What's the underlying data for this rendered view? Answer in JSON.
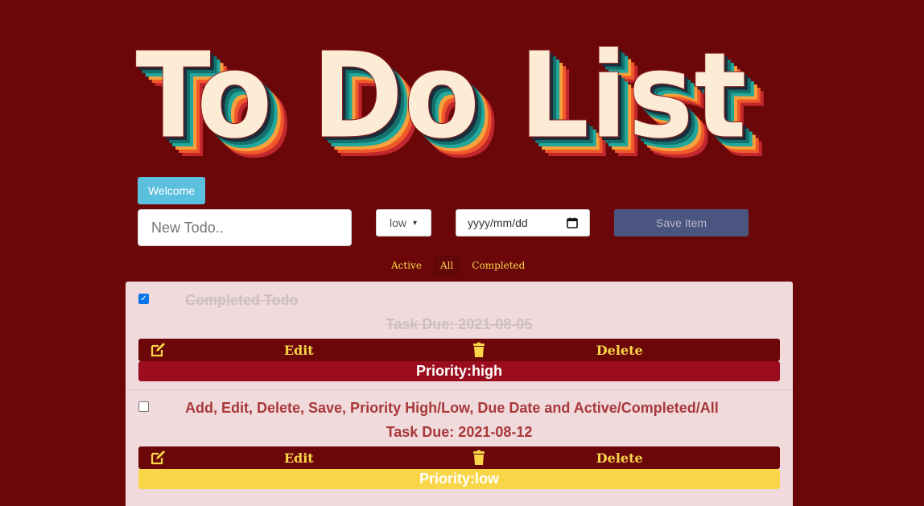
{
  "header": {
    "logo_text": "To Do List",
    "logo_shadow_colors": [
      "#c1272d",
      "#f0582a",
      "#f6a13b",
      "#21a79c",
      "#15716e",
      "#1b2d3b"
    ],
    "logo_face_color": "#fdecd5"
  },
  "welcome_button": {
    "label": "Welcome"
  },
  "form": {
    "todo_placeholder": "New Todo..",
    "priority_selected": "low",
    "date_placeholder": "yyyy/mm/dd",
    "save_label": "Save Item"
  },
  "filters": [
    {
      "label": "Active"
    },
    {
      "label": "All"
    },
    {
      "label": "Completed"
    }
  ],
  "active_filter": "All",
  "todos": [
    {
      "completed": true,
      "title": "Completed Todo",
      "due": "Task Due: 2021-08-05",
      "edit_label": "Edit",
      "delete_label": "Delete",
      "priority_label": "Priority:high",
      "priority_color": "#9b0d1e"
    },
    {
      "completed": false,
      "title": "Add, Edit, Delete, Save, Priority High/Low, Due Date and Active/Completed/All",
      "due": "Task Due: 2021-08-12",
      "edit_label": "Edit",
      "delete_label": "Delete",
      "priority_label": "Priority:low",
      "priority_color": "#f9d648"
    }
  ],
  "colors": {
    "background": "#6b0709",
    "accent_yellow": "#f9d648",
    "panel": "#f1dadc",
    "welcome": "#5bc0de",
    "save": "#4a5580"
  }
}
